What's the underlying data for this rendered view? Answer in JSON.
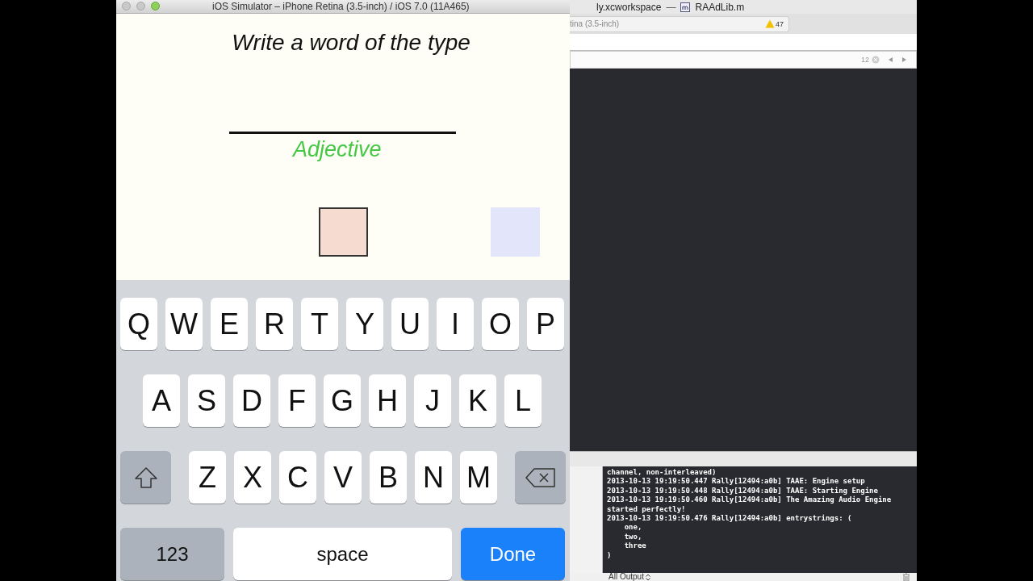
{
  "simulator": {
    "title": "iOS Simulator – iPhone Retina (3.5-inch) / iOS 7.0 (11A465)",
    "prompt": "Write a word of the type",
    "word_type": "Adjective",
    "swatches": [
      {
        "color": "#f6dcd0",
        "selected": true
      },
      {
        "color": "#e3e6fa",
        "selected": false
      }
    ],
    "keyboard": {
      "rows": [
        [
          "Q",
          "W",
          "E",
          "R",
          "T",
          "Y",
          "U",
          "I",
          "O",
          "P"
        ],
        [
          "A",
          "S",
          "D",
          "F",
          "G",
          "H",
          "J",
          "K",
          "L"
        ],
        [
          "Z",
          "X",
          "C",
          "V",
          "B",
          "N",
          "M"
        ]
      ],
      "number_key": "123",
      "space_key": "space",
      "done_key": "Done"
    }
  },
  "xcode": {
    "workspace": "ly.xcworkspace",
    "separator": "—",
    "file": "RAAdLib.m",
    "scheme": "tina (3.5-inch)",
    "warnings": "47",
    "match_count": "12",
    "console_lines": [
      "channel, non-interleaved)",
      "2013-10-13 19:19:50.447 Rally[12494:a0b] TAAE: Engine setup",
      "2013-10-13 19:19:50.448 Rally[12494:a0b] TAAE: Starting Engine",
      "2013-10-13 19:19:50.460 Rally[12494:a0b] The Amazing Audio Engine",
      "started perfectly!",
      "2013-10-13 19:19:50.476 Rally[12494:a0b] entrystrings: (",
      "    one,",
      "    two,",
      "    three",
      ")"
    ],
    "output_filter": "All Output"
  }
}
